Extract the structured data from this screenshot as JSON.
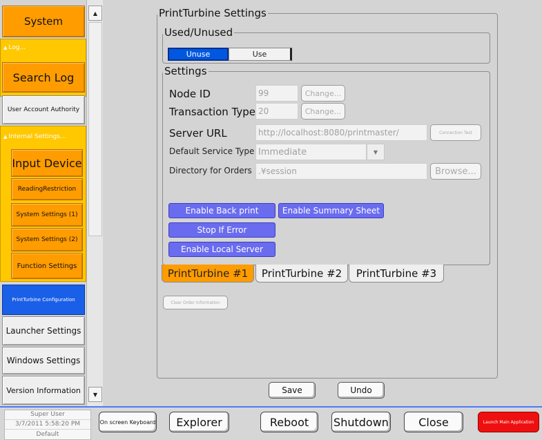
{
  "sidebar": {
    "system_label": "System",
    "log_group_label": "Log...",
    "search_log_label": "Search Log",
    "user_account_authority_label": "User Account Authority",
    "internal_settings_group_label": "Internal Settings...",
    "internal_items": [
      {
        "label": "Input Device"
      },
      {
        "label": "ReadingRestriction"
      },
      {
        "label": "System Settings (1)"
      },
      {
        "label": "System Settings (2)"
      },
      {
        "label": "Function Settings"
      }
    ],
    "printturbine_config_label": "PrintTurbine Configuration",
    "launcher_settings_label": "Launcher Settings",
    "windows_settings_label": "Windows Settings",
    "version_information_label": "Version Information",
    "scroll_up_glyph": "▲",
    "scroll_down_glyph": "▼",
    "group_caret_glyph": "▲"
  },
  "main": {
    "title": "PrintTurbine Settings",
    "used_unused": {
      "legend": "Used/Unused",
      "unuse_label": "Unuse",
      "use_label": "Use",
      "selected": "Unuse"
    },
    "settings": {
      "legend": "Settings",
      "node_id_label": "Node ID",
      "node_id_value": "99",
      "transaction_type_label": "Transaction Type",
      "transaction_type_value": "20",
      "change_label": "Change...",
      "server_url_label": "Server URL",
      "server_url_value": "http://localhost:8080/printmaster/",
      "connection_test_label": "Connection Test",
      "default_service_type_label": "Default Service Type",
      "default_service_type_value": "Immediate",
      "dropdown_glyph": "▼",
      "directory_for_orders_label": "Directory for Orders",
      "directory_for_orders_value": ".¥session",
      "browse_label": "Browse...",
      "enable_back_print_label": "Enable Back print",
      "enable_summary_sheet_label": "Enable Summary Sheet",
      "stop_if_error_label": "Stop If Error",
      "enable_local_server_label": "Enable Local Server"
    },
    "tabs": [
      {
        "label": "PrintTurbine #1",
        "active": true
      },
      {
        "label": "PrintTurbine #2",
        "active": false
      },
      {
        "label": "PrintTurbine #3",
        "active": false
      }
    ],
    "clear_order_information_label": "Clear Order Information",
    "save_label": "Save",
    "undo_label": "Undo"
  },
  "taskbar": {
    "user": "Super User",
    "datetime": "3/7/2011 5:58:20 PM",
    "profile": "Default",
    "on_screen_keyboard_label": "On screen Keyboard",
    "explorer_label": "Explorer",
    "reboot_label": "Reboot",
    "shutdown_label": "Shutdown",
    "close_label": "Close",
    "launch_main_application_label": "Launch Main Application"
  },
  "colors": {
    "background": "#d4d4d4",
    "sidebar_yellow": "#ffc800",
    "sidebar_orange": "#ff9c00",
    "selected_blue": "#1a5fe8",
    "option_purple": "#6a6cf0",
    "launch_red": "#ee1010",
    "taskbar_accent": "#4a7bff"
  }
}
